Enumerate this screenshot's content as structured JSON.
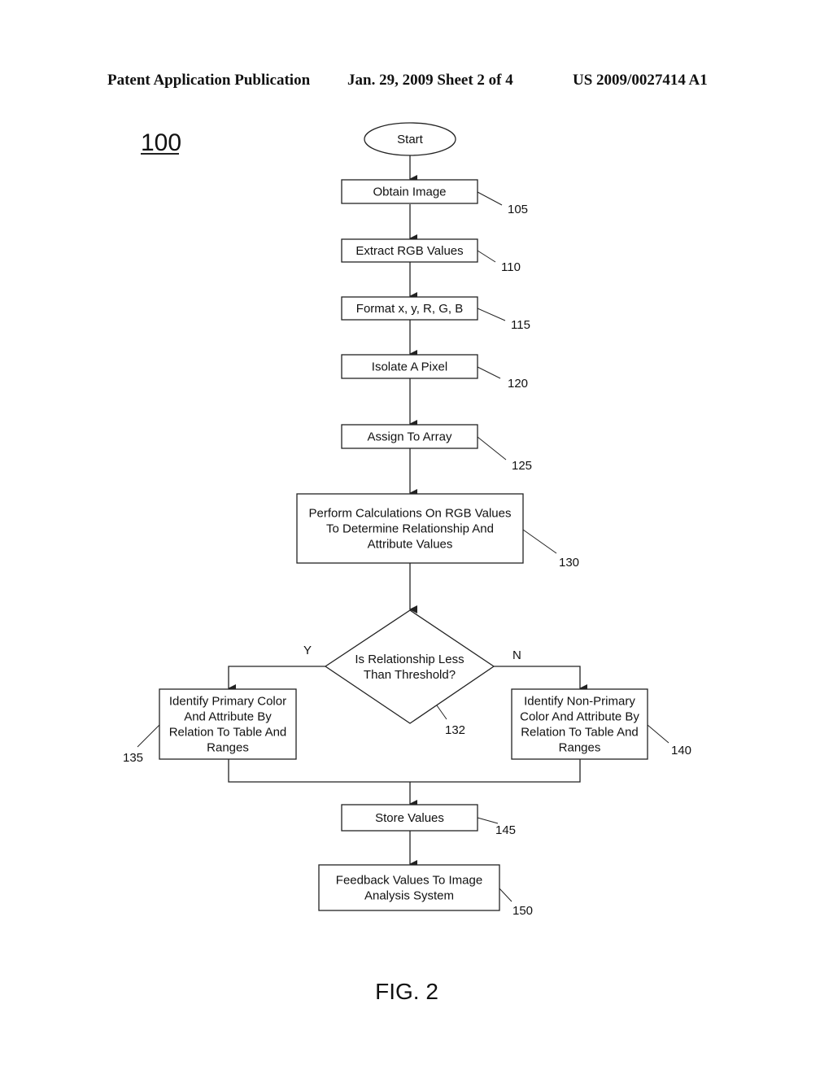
{
  "header": {
    "left": "Patent Application Publication",
    "middle": "Jan. 29, 2009  Sheet 2 of 4",
    "right": "US 2009/0027414 A1"
  },
  "diagram_id": "100",
  "figure_label": "FIG. 2",
  "nodes": [
    {
      "id": "start",
      "shape": "ellipse",
      "lines": [
        "Start"
      ],
      "ref": ""
    },
    {
      "id": "obtain-image",
      "shape": "rect",
      "lines": [
        "Obtain Image"
      ],
      "ref": "105"
    },
    {
      "id": "extract-rgb",
      "shape": "rect",
      "lines": [
        "Extract RGB Values"
      ],
      "ref": "110"
    },
    {
      "id": "format-xyrgb",
      "shape": "rect",
      "lines": [
        "Format x, y, R, G, B"
      ],
      "ref": "115"
    },
    {
      "id": "isolate-pixel",
      "shape": "rect",
      "lines": [
        "Isolate A Pixel"
      ],
      "ref": "120"
    },
    {
      "id": "assign-array",
      "shape": "rect",
      "lines": [
        "Assign To Array"
      ],
      "ref": "125"
    },
    {
      "id": "perform-calculations",
      "shape": "rect",
      "lines": [
        "Perform Calculations On RGB Values",
        "To Determine Relationship And",
        "Attribute Values"
      ],
      "ref": "130"
    },
    {
      "id": "threshold-decision",
      "shape": "diamond",
      "lines": [
        "Is Relationship Less",
        "Than Threshold?"
      ],
      "ref": "132"
    },
    {
      "id": "identify-primary",
      "shape": "rect",
      "lines": [
        "Identify Primary Color",
        "And Attribute By",
        "Relation To Table And",
        "Ranges"
      ],
      "ref": "135"
    },
    {
      "id": "identify-non-primary",
      "shape": "rect",
      "lines": [
        "Identify Non-Primary",
        "Color And Attribute By",
        "Relation To Table And",
        "Ranges"
      ],
      "ref": "140"
    },
    {
      "id": "store-values",
      "shape": "rect",
      "lines": [
        "Store Values"
      ],
      "ref": "145"
    },
    {
      "id": "feedback-values",
      "shape": "rect",
      "lines": [
        "Feedback Values To Image",
        "Analysis System"
      ],
      "ref": "150"
    }
  ],
  "branches": {
    "yes_label": "Y",
    "no_label": "N"
  }
}
